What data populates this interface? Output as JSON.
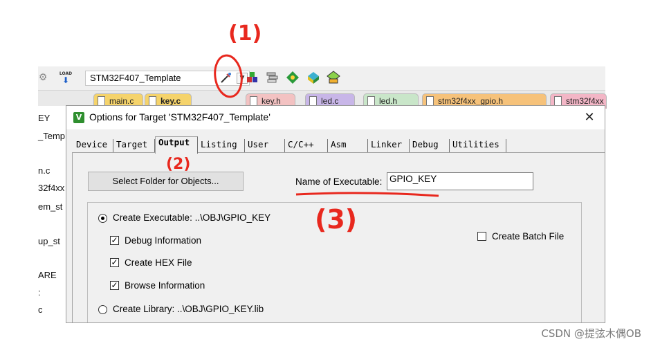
{
  "toolbar": {
    "target_name": "STM32F407_Template",
    "load_icon_label": "LOAD",
    "icons": [
      "setup-icon",
      "load-icon",
      "target-options-icon",
      "file-extensions-icon",
      "manage-rte-icon",
      "select-packs-icon",
      "pack-installer-icon",
      "event-recorder-icon"
    ]
  },
  "file_tabs": [
    {
      "label": "main.c",
      "color": "#f5d36b"
    },
    {
      "label": "key.c",
      "color": "#f5d36b"
    },
    {
      "label": "key.h",
      "color": "#f3c2c2"
    },
    {
      "label": "led.c",
      "color": "#c8b6e8"
    },
    {
      "label": "led.h",
      "color": "#c9e6c9"
    },
    {
      "label": "stm32f4xx_gpio.h",
      "color": "#f6c27a"
    },
    {
      "label": "stm32f4xx",
      "color": "#f3b6c6"
    }
  ],
  "left_panel": {
    "pin_icon": "pin-icon",
    "close_icon": "close-x-icon",
    "items": [
      "EY",
      "_Temp",
      "n.c",
      "32f4xx",
      "em_st",
      "up_st",
      "ARE",
      ":",
      "c"
    ]
  },
  "dialog": {
    "title": "Options for Target 'STM32F407_Template'",
    "close_glyph": "✕",
    "tabs": [
      "Device",
      "Target",
      "Output",
      "Listing",
      "User",
      "C/C++",
      "Asm",
      "Linker",
      "Debug",
      "Utilities"
    ],
    "active_tab": "Output",
    "select_folder_button": "Select Folder for Objects...",
    "name_of_executable_label": "Name of Executable:",
    "name_of_executable_value": "GPIO_KEY",
    "create_executable_label": "Create Executable:  ..\\OBJ\\GPIO_KEY",
    "create_executable_selected": true,
    "debug_information_label": "Debug Information",
    "debug_information_checked": true,
    "create_hex_label": "Create HEX File",
    "create_hex_checked": true,
    "browse_information_label": "Browse Information",
    "browse_information_checked": true,
    "create_batch_label": "Create Batch File",
    "create_batch_checked": false,
    "create_library_label": "Create Library:  ..\\OBJ\\GPIO_KEY.lib",
    "create_library_selected": false
  },
  "annotations": {
    "step1": "(1)",
    "step2": "(2)",
    "step3": "(3)",
    "color": "#e8281e"
  },
  "watermark": "CSDN @提弦木偶OB"
}
